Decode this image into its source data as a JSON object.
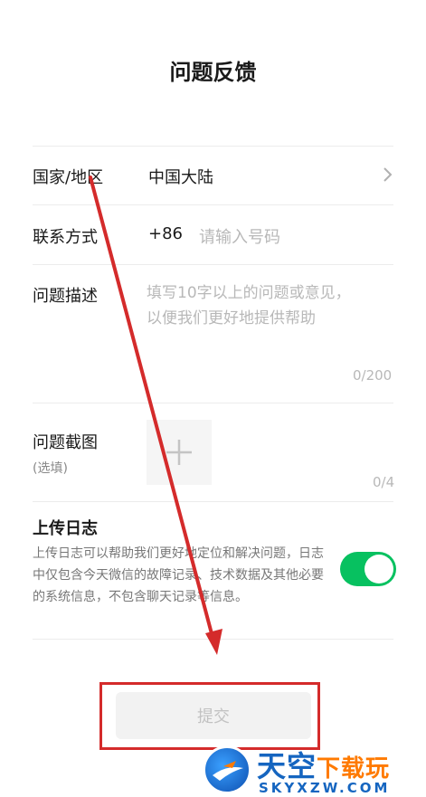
{
  "header": {
    "title": "问题反馈"
  },
  "form": {
    "region": {
      "label": "国家/地区",
      "value": "中国大陆"
    },
    "contact": {
      "label": "联系方式",
      "prefix": "+86",
      "placeholder": "请输入号码"
    },
    "description": {
      "label": "问题描述",
      "placeholder_line1": "填写10字以上的问题或意见，",
      "placeholder_line2": "以便我们更好地提供帮助",
      "counter": "0/200"
    },
    "screenshot": {
      "label": "问题截图",
      "optional": "(选填)",
      "counter": "0/4"
    },
    "upload_log": {
      "title": "上传日志",
      "description": "上传日志可以帮助我们更好地定位和解决问题，日志中仅包含今天微信的故障记录、技术数据及其他必要的系统信息，不包含聊天记录等信息。",
      "enabled": true
    },
    "submit_label": "提交"
  },
  "watermark": {
    "main_blue": "天空",
    "main_orange": "下载玩",
    "sub": "SKYXZW.COM"
  },
  "colors": {
    "toggle_on": "#07c160",
    "annotation_red": "#d42b2b",
    "placeholder": "#b8b8b8"
  }
}
